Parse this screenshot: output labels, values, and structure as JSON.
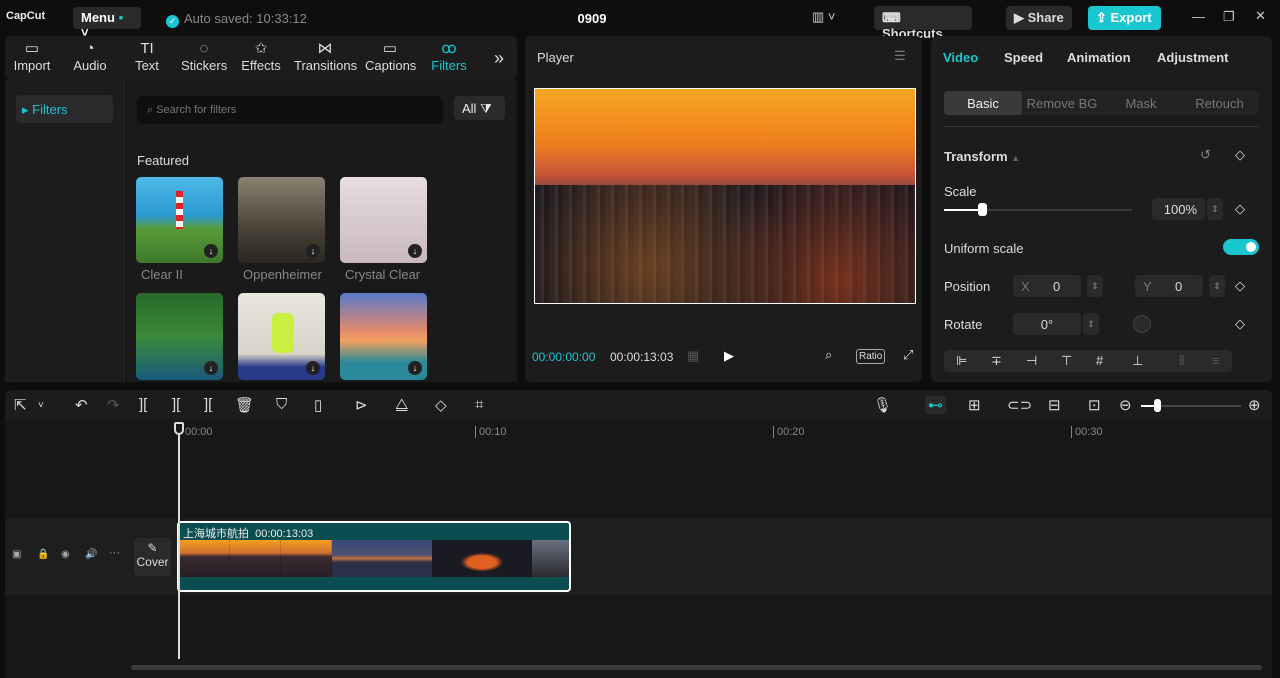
{
  "app": {
    "logo": "CapCut",
    "menu": "Menu",
    "autosave": "Auto saved: 10:33:12",
    "title": "0909",
    "shortcuts": "Shortcuts",
    "share": "Share",
    "export": "Export"
  },
  "tabs": [
    {
      "label": "Import",
      "icon": "▭"
    },
    {
      "label": "Audio",
      "icon": "◔"
    },
    {
      "label": "Text",
      "icon": "TI"
    },
    {
      "label": "Stickers",
      "icon": "◌"
    },
    {
      "label": "Effects",
      "icon": "✩"
    },
    {
      "label": "Transitions",
      "icon": "⋈"
    },
    {
      "label": "Captions",
      "icon": "▭"
    },
    {
      "label": "Filters",
      "icon": "ꝏ"
    }
  ],
  "sidebar": {
    "item": "Filters"
  },
  "filters": {
    "search_placeholder": "Search for filters",
    "all": "All",
    "section": "Featured",
    "items": [
      "Clear II",
      "Oppenheimer",
      "Crystal Clear"
    ]
  },
  "player": {
    "title": "Player",
    "current": "00:00:00:00",
    "total": "00:00:13:03",
    "ratio": "Ratio"
  },
  "inspector": {
    "tabs": [
      "Video",
      "Speed",
      "Animation",
      "Adjustment"
    ],
    "subtabs": [
      "Basic",
      "Remove BG",
      "Mask",
      "Retouch"
    ],
    "section": "Transform",
    "scale_label": "Scale",
    "scale": "100%",
    "scale_fraction": 0.2,
    "uniform": "Uniform scale",
    "uniform_on": true,
    "position": "Position",
    "x_label": "X",
    "x": "0",
    "y_label": "Y",
    "y": "0",
    "rotate": "Rotate",
    "rotate_val": "0°"
  },
  "timeline": {
    "ticks": [
      "00:00",
      "00:10",
      "00:20",
      "00:30"
    ],
    "cover": "Cover",
    "clip_name": "上海城市航拍",
    "clip_duration": "00:00:13:03"
  },
  "colors": {
    "accent": "#1ac6d0"
  }
}
